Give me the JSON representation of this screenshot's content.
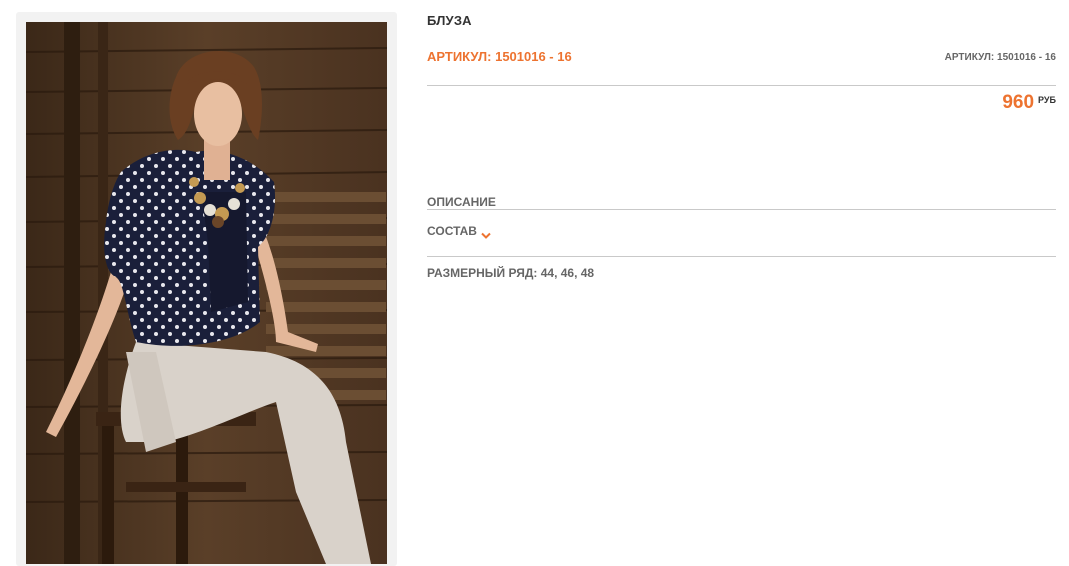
{
  "product": {
    "title": "БЛУЗА",
    "sku_label": "АРТИКУЛ: 1501016 - 16",
    "sku_label_small": "АРТИКУЛ: 1501016 - 16",
    "price": "960",
    "currency": "РУБ"
  },
  "sections": {
    "description": "ОПИСАНИЕ",
    "composition": "СОСТАВ",
    "size_range": "РАЗМЕРНЫЙ РЯД: 44, 46, 48"
  },
  "icons": {
    "composition_toggle": "chevron-down-icon"
  },
  "colors": {
    "accent": "#ed7330",
    "text_dark": "#333333",
    "text_muted": "#666666",
    "divider": "#c9c9c9"
  }
}
